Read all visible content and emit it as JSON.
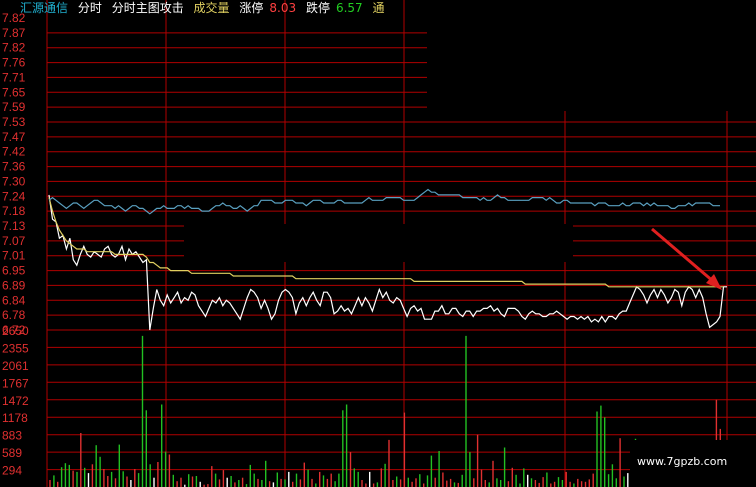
{
  "header": {
    "name": "汇源通信",
    "tab_fenshi": "分时",
    "tab_main": "分时主图攻击",
    "volume_label": "成交量",
    "limit_up_label": "涨停",
    "limit_up_value": "8.03",
    "limit_down_label": "跌停",
    "limit_down_value": "6.57",
    "truncated_label": "通"
  },
  "watermark": "www.7gpzb.com",
  "colors": {
    "grid": "#b00000",
    "price_line": "#ffffff",
    "avg_line": "#e0d060",
    "index_line": "#5aa0c0",
    "axis_text_top": "#e03030",
    "axis_text_bottom": "#e03030",
    "vol_up": "#e03030",
    "vol_down": "#22c022",
    "vol_flat": "#ffffff",
    "limit_up": "#ff4040",
    "limit_down": "#22cc22",
    "name": "#20b0d0",
    "volume_label": "#e0d060",
    "arrow": "#e02020"
  },
  "chart_data": {
    "type": "line",
    "price_axis_ticks": [
      "7.82",
      "7.87",
      "7.82",
      "7.76",
      "7.71",
      "7.65",
      "7.59",
      "7.53",
      "7.47",
      "7.42",
      "7.36",
      "7.30",
      "7.24",
      "7.18",
      "7.13",
      "7.07",
      "7.01",
      "6.95",
      "6.89",
      "6.84",
      "6.78",
      "6.72"
    ],
    "volume_axis_ticks": [
      "2650",
      "2355",
      "2061",
      "1767",
      "1472",
      "1178",
      "883",
      "589",
      "294"
    ],
    "series": [
      {
        "values": [
          7.22,
          7.13,
          7.12,
          7.06,
          7.07,
          7.02,
          7.06,
          6.98,
          6.96,
          7.0,
          7.03,
          7.0,
          6.99,
          7.01,
          7.0,
          6.99,
          7.02,
          7.03,
          7.0,
          6.99,
          7.0,
          7.03,
          6.98,
          7.02,
          7.0,
          7.01,
          6.99,
          6.97,
          6.98,
          6.72,
          6.8,
          6.87,
          6.83,
          6.81,
          6.85,
          6.82,
          6.84,
          6.86,
          6.82,
          6.84,
          6.83,
          6.86,
          6.85,
          6.81,
          6.79,
          6.77,
          6.8,
          6.83,
          6.82,
          6.84,
          6.81,
          6.83,
          6.82,
          6.8,
          6.78,
          6.76,
          6.8,
          6.84,
          6.87,
          6.86,
          6.84,
          6.8,
          6.83,
          6.8,
          6.76,
          6.78,
          6.83,
          6.86,
          6.87,
          6.86,
          6.84,
          6.78,
          6.82,
          6.84,
          6.81,
          6.84,
          6.86,
          6.83,
          6.81,
          6.86,
          6.86,
          6.84,
          6.78,
          6.79,
          6.81,
          6.79,
          6.8,
          6.78,
          6.81,
          6.84,
          6.81,
          6.84,
          6.82,
          6.79,
          6.83,
          6.87,
          6.84,
          6.86,
          6.83,
          6.82,
          6.84,
          6.83,
          6.8,
          6.77,
          6.8,
          6.81,
          6.79,
          6.8,
          6.76,
          6.76,
          6.76,
          6.79,
          6.79,
          6.81,
          6.78,
          6.78,
          6.8,
          6.8,
          6.78,
          6.77,
          6.79,
          6.79,
          6.77,
          6.79,
          6.79,
          6.8,
          6.8,
          6.81,
          6.79,
          6.8,
          6.78,
          6.77,
          6.8,
          6.8,
          6.8,
          6.79,
          6.77,
          6.76,
          6.78,
          6.79,
          6.78,
          6.78,
          6.77,
          6.77,
          6.78,
          6.78,
          6.79,
          6.78,
          6.77,
          6.76,
          6.77,
          6.77,
          6.76,
          6.77,
          6.76,
          6.77,
          6.75,
          6.76,
          6.75,
          6.77,
          6.75,
          6.77,
          6.77,
          6.76,
          6.78,
          6.79,
          6.79,
          6.82,
          6.85,
          6.88,
          6.87,
          6.85,
          6.82,
          6.85,
          6.87,
          6.84,
          6.87,
          6.85,
          6.82,
          6.84,
          6.87,
          6.86,
          6.81,
          6.86,
          6.88,
          6.87,
          6.84,
          6.87,
          6.84,
          6.78,
          6.73,
          6.74,
          6.75,
          6.77,
          6.88,
          6.88
        ]
      },
      {
        "values": [
          7.21,
          7.16,
          7.12,
          7.09,
          7.07,
          7.05,
          7.04,
          7.03,
          7.02,
          7.02,
          7.02,
          7.01,
          7.01,
          7.01,
          7.01,
          7.01,
          7.01,
          7.01,
          7.01,
          7.0,
          7.0,
          7.0,
          7.0,
          7.0,
          7.0,
          7.0,
          7.0,
          7.0,
          6.99,
          6.97,
          6.97,
          6.96,
          6.95,
          6.95,
          6.95,
          6.94,
          6.94,
          6.94,
          6.94,
          6.94,
          6.94,
          6.93,
          6.93,
          6.93,
          6.93,
          6.93,
          6.93,
          6.93,
          6.93,
          6.93,
          6.93,
          6.93,
          6.93,
          6.92,
          6.92,
          6.92,
          6.92,
          6.92,
          6.92,
          6.92,
          6.92,
          6.92,
          6.92,
          6.92,
          6.92,
          6.92,
          6.92,
          6.92,
          6.92,
          6.92,
          6.92,
          6.91,
          6.91,
          6.91,
          6.91,
          6.91,
          6.91,
          6.91,
          6.91,
          6.91,
          6.91,
          6.91,
          6.91,
          6.91,
          6.91,
          6.91,
          6.91,
          6.91,
          6.91,
          6.91,
          6.91,
          6.91,
          6.91,
          6.91,
          6.91,
          6.91,
          6.91,
          6.91,
          6.91,
          6.91,
          6.91,
          6.91,
          6.91,
          6.91,
          6.91,
          6.9,
          6.9,
          6.9,
          6.9,
          6.9,
          6.9,
          6.9,
          6.9,
          6.9,
          6.9,
          6.9,
          6.9,
          6.9,
          6.9,
          6.9,
          6.9,
          6.9,
          6.9,
          6.9,
          6.9,
          6.9,
          6.9,
          6.9,
          6.9,
          6.9,
          6.9,
          6.9,
          6.9,
          6.9,
          6.9,
          6.9,
          6.9,
          6.89,
          6.89,
          6.89,
          6.89,
          6.89,
          6.89,
          6.89,
          6.89,
          6.89,
          6.89,
          6.89,
          6.89,
          6.89,
          6.89,
          6.89,
          6.89,
          6.89,
          6.89,
          6.89,
          6.89,
          6.89,
          6.89,
          6.89,
          6.89,
          6.88,
          6.88,
          6.88,
          6.88,
          6.88,
          6.88,
          6.88,
          6.88,
          6.88,
          6.88,
          6.88,
          6.88,
          6.88,
          6.88,
          6.88,
          6.88,
          6.88,
          6.88,
          6.88,
          6.88,
          6.88,
          6.88,
          6.88,
          6.88,
          6.88,
          6.88,
          6.88,
          6.88,
          6.88,
          6.88,
          6.88,
          6.88,
          6.88,
          6.88
        ]
      },
      {
        "values": [
          7.2,
          7.21,
          7.2,
          7.19,
          7.18,
          7.17,
          7.18,
          7.19,
          7.19,
          7.18,
          7.17,
          7.18,
          7.19,
          7.2,
          7.2,
          7.19,
          7.18,
          7.18,
          7.18,
          7.17,
          7.18,
          7.17,
          7.16,
          7.17,
          7.18,
          7.18,
          7.17,
          7.17,
          7.16,
          7.15,
          7.16,
          7.17,
          7.17,
          7.18,
          7.17,
          7.17,
          7.17,
          7.18,
          7.18,
          7.17,
          7.18,
          7.17,
          7.17,
          7.17,
          7.16,
          7.16,
          7.16,
          7.17,
          7.18,
          7.18,
          7.19,
          7.18,
          7.18,
          7.17,
          7.17,
          7.18,
          7.17,
          7.16,
          7.17,
          7.18,
          7.18,
          7.2,
          7.2,
          7.2,
          7.2,
          7.19,
          7.19,
          7.19,
          7.2,
          7.2,
          7.2,
          7.19,
          7.19,
          7.19,
          7.18,
          7.19,
          7.2,
          7.2,
          7.2,
          7.19,
          7.19,
          7.19,
          7.19,
          7.2,
          7.2,
          7.19,
          7.19,
          7.19,
          7.19,
          7.19,
          7.19,
          7.2,
          7.21,
          7.2,
          7.2,
          7.2,
          7.2,
          7.21,
          7.21,
          7.21,
          7.21,
          7.21,
          7.2,
          7.2,
          7.2,
          7.2,
          7.21,
          7.22,
          7.23,
          7.24,
          7.23,
          7.23,
          7.22,
          7.22,
          7.22,
          7.22,
          7.22,
          7.22,
          7.22,
          7.21,
          7.21,
          7.21,
          7.21,
          7.21,
          7.2,
          7.21,
          7.2,
          7.2,
          7.21,
          7.22,
          7.21,
          7.21,
          7.2,
          7.2,
          7.2,
          7.2,
          7.2,
          7.2,
          7.2,
          7.21,
          7.21,
          7.21,
          7.21,
          7.2,
          7.21,
          7.2,
          7.19,
          7.19,
          7.2,
          7.2,
          7.19,
          7.19,
          7.19,
          7.19,
          7.19,
          7.19,
          7.19,
          7.18,
          7.19,
          7.19,
          7.19,
          7.18,
          7.18,
          7.18,
          7.18,
          7.19,
          7.18,
          7.18,
          7.19,
          7.19,
          7.19,
          7.18,
          7.19,
          7.18,
          7.19,
          7.18,
          7.18,
          7.18,
          7.18,
          7.17,
          7.17,
          7.18,
          7.18,
          7.18,
          7.19,
          7.18,
          7.19,
          7.19,
          7.19,
          7.19,
          7.19,
          7.18,
          7.18,
          7.18
        ]
      }
    ],
    "volume": [
      {
        "v": 120,
        "c": "up"
      },
      {
        "v": 200,
        "c": "dn"
      },
      {
        "v": 90,
        "c": "up"
      },
      {
        "v": 340,
        "c": "dn"
      },
      {
        "v": 410,
        "c": "dn"
      },
      {
        "v": 380,
        "c": "dn"
      },
      {
        "v": 280,
        "c": "up"
      },
      {
        "v": 260,
        "c": "dn"
      },
      {
        "v": 930,
        "c": "up"
      },
      {
        "v": 330,
        "c": "dn"
      },
      {
        "v": 240,
        "c": "fl"
      },
      {
        "v": 390,
        "c": "up"
      },
      {
        "v": 720,
        "c": "dn"
      },
      {
        "v": 520,
        "c": "dn"
      },
      {
        "v": 310,
        "c": "up"
      },
      {
        "v": 190,
        "c": "up"
      },
      {
        "v": 260,
        "c": "dn"
      },
      {
        "v": 150,
        "c": "up"
      },
      {
        "v": 730,
        "c": "dn"
      },
      {
        "v": 270,
        "c": "dn"
      },
      {
        "v": 180,
        "c": "up"
      },
      {
        "v": 120,
        "c": "fl"
      },
      {
        "v": 310,
        "c": "up"
      },
      {
        "v": 240,
        "c": "dn"
      },
      {
        "v": 2600,
        "c": "dn"
      },
      {
        "v": 1320,
        "c": "dn"
      },
      {
        "v": 390,
        "c": "dn"
      },
      {
        "v": 160,
        "c": "fl"
      },
      {
        "v": 430,
        "c": "up"
      },
      {
        "v": 1420,
        "c": "dn"
      },
      {
        "v": 610,
        "c": "dn"
      },
      {
        "v": 560,
        "c": "up"
      },
      {
        "v": 210,
        "c": "dn"
      },
      {
        "v": 100,
        "c": "up"
      },
      {
        "v": 160,
        "c": "up"
      },
      {
        "v": 40,
        "c": "fl"
      },
      {
        "v": 220,
        "c": "dn"
      },
      {
        "v": 180,
        "c": "up"
      },
      {
        "v": 190,
        "c": "dn"
      },
      {
        "v": 90,
        "c": "fl"
      },
      {
        "v": 40,
        "c": "up"
      },
      {
        "v": 50,
        "c": "up"
      },
      {
        "v": 360,
        "c": "up"
      },
      {
        "v": 230,
        "c": "dn"
      },
      {
        "v": 130,
        "c": "up"
      },
      {
        "v": 290,
        "c": "up"
      },
      {
        "v": 160,
        "c": "fl"
      },
      {
        "v": 190,
        "c": "dn"
      },
      {
        "v": 80,
        "c": "up"
      },
      {
        "v": 120,
        "c": "dn"
      },
      {
        "v": 160,
        "c": "up"
      },
      {
        "v": 50,
        "c": "dn"
      },
      {
        "v": 380,
        "c": "dn"
      },
      {
        "v": 230,
        "c": "dn"
      },
      {
        "v": 140,
        "c": "up"
      },
      {
        "v": 120,
        "c": "dn"
      },
      {
        "v": 450,
        "c": "dn"
      },
      {
        "v": 100,
        "c": "up"
      },
      {
        "v": 80,
        "c": "fl"
      },
      {
        "v": 250,
        "c": "dn"
      },
      {
        "v": 140,
        "c": "up"
      },
      {
        "v": 130,
        "c": "dn"
      },
      {
        "v": 260,
        "c": "fl"
      },
      {
        "v": 90,
        "c": "up"
      },
      {
        "v": 230,
        "c": "dn"
      },
      {
        "v": 130,
        "c": "up"
      },
      {
        "v": 420,
        "c": "up"
      },
      {
        "v": 300,
        "c": "dn"
      },
      {
        "v": 140,
        "c": "up"
      },
      {
        "v": 60,
        "c": "dn"
      },
      {
        "v": 260,
        "c": "up"
      },
      {
        "v": 200,
        "c": "dn"
      },
      {
        "v": 140,
        "c": "up"
      },
      {
        "v": 230,
        "c": "up"
      },
      {
        "v": 100,
        "c": "dn"
      },
      {
        "v": 230,
        "c": "dn"
      },
      {
        "v": 1320,
        "c": "dn"
      },
      {
        "v": 1420,
        "c": "dn"
      },
      {
        "v": 600,
        "c": "up"
      },
      {
        "v": 320,
        "c": "dn"
      },
      {
        "v": 260,
        "c": "dn"
      },
      {
        "v": 120,
        "c": "up"
      },
      {
        "v": 60,
        "c": "up"
      },
      {
        "v": 260,
        "c": "fl"
      },
      {
        "v": 60,
        "c": "up"
      },
      {
        "v": 80,
        "c": "dn"
      },
      {
        "v": 320,
        "c": "up"
      },
      {
        "v": 400,
        "c": "dn"
      },
      {
        "v": 810,
        "c": "up"
      },
      {
        "v": 120,
        "c": "up"
      },
      {
        "v": 180,
        "c": "dn"
      },
      {
        "v": 130,
        "c": "up"
      },
      {
        "v": 1280,
        "c": "up"
      },
      {
        "v": 160,
        "c": "dn"
      },
      {
        "v": 90,
        "c": "up"
      },
      {
        "v": 150,
        "c": "up"
      },
      {
        "v": 220,
        "c": "dn"
      },
      {
        "v": 60,
        "c": "up"
      },
      {
        "v": 200,
        "c": "dn"
      },
      {
        "v": 540,
        "c": "dn"
      },
      {
        "v": 160,
        "c": "up"
      },
      {
        "v": 620,
        "c": "dn"
      },
      {
        "v": 250,
        "c": "up"
      },
      {
        "v": 110,
        "c": "up"
      },
      {
        "v": 140,
        "c": "up"
      },
      {
        "v": 80,
        "c": "dn"
      },
      {
        "v": 70,
        "c": "up"
      },
      {
        "v": 210,
        "c": "dn"
      },
      {
        "v": 2600,
        "c": "dn"
      },
      {
        "v": 600,
        "c": "dn"
      },
      {
        "v": 150,
        "c": "up"
      },
      {
        "v": 900,
        "c": "up"
      },
      {
        "v": 300,
        "c": "up"
      },
      {
        "v": 120,
        "c": "up"
      },
      {
        "v": 80,
        "c": "dn"
      },
      {
        "v": 450,
        "c": "up"
      },
      {
        "v": 150,
        "c": "dn"
      },
      {
        "v": 120,
        "c": "dn"
      },
      {
        "v": 680,
        "c": "dn"
      },
      {
        "v": 100,
        "c": "up"
      },
      {
        "v": 330,
        "c": "up"
      },
      {
        "v": 210,
        "c": "dn"
      },
      {
        "v": 60,
        "c": "dn"
      },
      {
        "v": 320,
        "c": "dn"
      },
      {
        "v": 210,
        "c": "fl"
      },
      {
        "v": 150,
        "c": "dn"
      },
      {
        "v": 120,
        "c": "up"
      },
      {
        "v": 70,
        "c": "up"
      },
      {
        "v": 170,
        "c": "up"
      },
      {
        "v": 250,
        "c": "dn"
      },
      {
        "v": 60,
        "c": "up"
      },
      {
        "v": 90,
        "c": "up"
      },
      {
        "v": 170,
        "c": "dn"
      },
      {
        "v": 120,
        "c": "dn"
      },
      {
        "v": 260,
        "c": "up"
      },
      {
        "v": 90,
        "c": "up"
      },
      {
        "v": 60,
        "c": "dn"
      },
      {
        "v": 140,
        "c": "up"
      },
      {
        "v": 100,
        "c": "up"
      },
      {
        "v": 90,
        "c": "up"
      },
      {
        "v": 130,
        "c": "up"
      },
      {
        "v": 230,
        "c": "up"
      },
      {
        "v": 1300,
        "c": "dn"
      },
      {
        "v": 1400,
        "c": "dn"
      },
      {
        "v": 1200,
        "c": "dn"
      },
      {
        "v": 220,
        "c": "dn"
      },
      {
        "v": 390,
        "c": "dn"
      },
      {
        "v": 150,
        "c": "dn"
      },
      {
        "v": 840,
        "c": "up"
      },
      {
        "v": 180,
        "c": "dn"
      },
      {
        "v": 240,
        "c": "fl"
      },
      {
        "v": 150,
        "c": "up"
      },
      {
        "v": 830,
        "c": "dn"
      },
      {
        "v": 150,
        "c": "up"
      },
      {
        "v": 120,
        "c": "up"
      },
      {
        "v": 420,
        "c": "dn"
      },
      {
        "v": 220,
        "c": "up"
      },
      {
        "v": 110,
        "c": "up"
      },
      {
        "v": 90,
        "c": "up"
      },
      {
        "v": 80,
        "c": "up"
      },
      {
        "v": 90,
        "c": "dn"
      },
      {
        "v": 70,
        "c": "up"
      },
      {
        "v": 180,
        "c": "dn"
      },
      {
        "v": 240,
        "c": "up"
      },
      {
        "v": 290,
        "c": "up"
      },
      {
        "v": 580,
        "c": "up"
      },
      {
        "v": 150,
        "c": "up"
      },
      {
        "v": 120,
        "c": "dn"
      },
      {
        "v": 50,
        "c": "up"
      },
      {
        "v": 140,
        "c": "up"
      },
      {
        "v": 100,
        "c": "up"
      },
      {
        "v": 80,
        "c": "dn"
      },
      {
        "v": 110,
        "c": "up"
      },
      {
        "v": 1500,
        "c": "up"
      },
      {
        "v": 1000,
        "c": "up"
      },
      {
        "v": 180,
        "c": "fl"
      }
    ]
  }
}
